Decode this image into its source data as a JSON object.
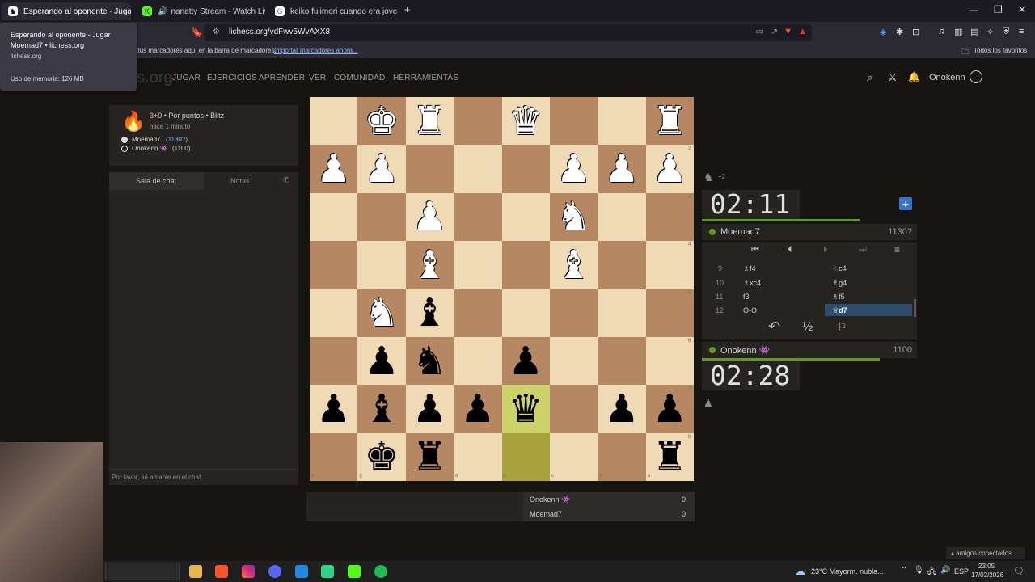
{
  "browser": {
    "tabs": [
      {
        "label": "Esperando al oponente - Jugar M...",
        "active": true
      },
      {
        "label": "nanatty Stream - Watch Live on K..."
      },
      {
        "label": "keiko fujimori cuando era joven - Bu..."
      }
    ],
    "url": "lichess.org/vdFwv5WvAXX8",
    "bookmarks_hint": "Para lograr un acceso rápido, coloca tus marcadores aquí en la barra de marcadores.",
    "bookmarks_link": "Importar marcadores ahora...",
    "all_bookmarks": "Todos los favoritos",
    "tooltip": {
      "title": "Esperando al oponente - Jugar Moemad7 • lichess.org",
      "domain": "lichess.org",
      "memory": "Uso de memoria: 126 MB"
    }
  },
  "site": {
    "logo": "lichess.org",
    "nav": [
      "JUGAR",
      "EJERCICIOS",
      "APRENDER",
      "VER",
      "COMUNIDAD",
      "HERRAMIENTAS"
    ],
    "username": "Onokenn"
  },
  "game_info": {
    "mode": "3+0 • Por puntos • Blitz",
    "time_ago": "hace 1 minuto",
    "white_player": "Moemad7",
    "white_rating": "(1130?)",
    "black_player": "Onokenn 👾",
    "black_rating": "(1100)"
  },
  "chat": {
    "tab_chat": "Sala de chat",
    "tab_notes": "Notas",
    "placeholder": "Por favor, sé amable en el chat"
  },
  "board": {
    "ranks": [
      [
        "",
        "wK",
        "wR",
        "",
        "wQ",
        "",
        "",
        "wR"
      ],
      [
        "wP",
        "wP",
        "",
        "",
        "",
        "wP",
        "wP",
        "wP"
      ],
      [
        "",
        "",
        "wP",
        "",
        "",
        "wN",
        "",
        ""
      ],
      [
        "",
        "",
        "wB",
        "",
        "",
        "wB",
        "",
        ""
      ],
      [
        "",
        "wN",
        "bB",
        "",
        "",
        "",
        "",
        ""
      ],
      [
        "",
        "bP",
        "bN",
        "",
        "bP",
        "",
        "",
        ""
      ],
      [
        "bP",
        "bB",
        "bP",
        "bP",
        "bQ",
        "",
        "bP",
        "bP"
      ],
      [
        "",
        "bK",
        "bR",
        "",
        "",
        "",
        "",
        "bR"
      ]
    ],
    "highlight_from": [
      7,
      4
    ],
    "highlight_to": [
      6,
      4
    ],
    "files": [
      "h",
      "g",
      "f",
      "e",
      "d",
      "c",
      "b",
      "a"
    ],
    "ranks_labels": [
      "1",
      "2",
      "3",
      "4",
      "5",
      "6",
      "7",
      "8"
    ]
  },
  "opponent": {
    "clock": "02:11",
    "name": "Moemad7",
    "rating": "1130?",
    "material": "+2"
  },
  "me": {
    "clock": "02:28",
    "name": "Onokenn 👾",
    "rating": "1100"
  },
  "moves": [
    {
      "num": "9",
      "white": "♗f4",
      "black": "♘c4"
    },
    {
      "num": "10",
      "white": "♗xc4",
      "black": "♗g4"
    },
    {
      "num": "11",
      "white": "f3",
      "black": "♗f5"
    },
    {
      "num": "12",
      "white": "O-O",
      "black": "♕d7"
    }
  ],
  "scores": [
    {
      "name": "Onokenn 👾",
      "score": "0"
    },
    {
      "name": "Moemad7",
      "score": "0"
    }
  ],
  "taskbar": {
    "weather": "23°C  Mayorm. nubla...",
    "lang": "ESP",
    "time": "23:05",
    "date": "17/02/2026",
    "friends": "amigos conectados"
  }
}
